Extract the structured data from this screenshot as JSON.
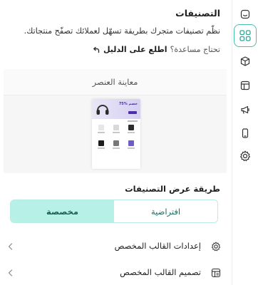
{
  "header": {
    "title": "التصنيفات",
    "description": "نظّم تصنيفات متجرك بطريقة تسهّل لعملائك تصفّح منتجاتك.",
    "help_question": "تحتاج مساعدة؟",
    "help_link": "اطلع على الدليل"
  },
  "preview": {
    "title": "معاينة العنصر",
    "mock_offer": "75% خصم"
  },
  "display_mode": {
    "label": "طريقة عرض التصنيفات",
    "options": [
      "افتراضية",
      "مخصصة"
    ],
    "selected": "مخصصة"
  },
  "rows": [
    {
      "label": "إعدادات القالب المخصص",
      "icon": "gear-icon"
    },
    {
      "label": "تصميم القالب المخصص",
      "icon": "layout-icon"
    }
  ],
  "rail": {
    "items": [
      "smile-icon",
      "grid-icon",
      "box-icon",
      "layout-icon",
      "megaphone-icon",
      "mobile-icon",
      "gear-icon"
    ],
    "active": "grid-icon"
  },
  "colors": {
    "accent": "#48c0b0",
    "segment_selected_bg": "#b6f0e6",
    "segment_border": "#b9ece3",
    "mock_purple": "#4a2fa8"
  }
}
